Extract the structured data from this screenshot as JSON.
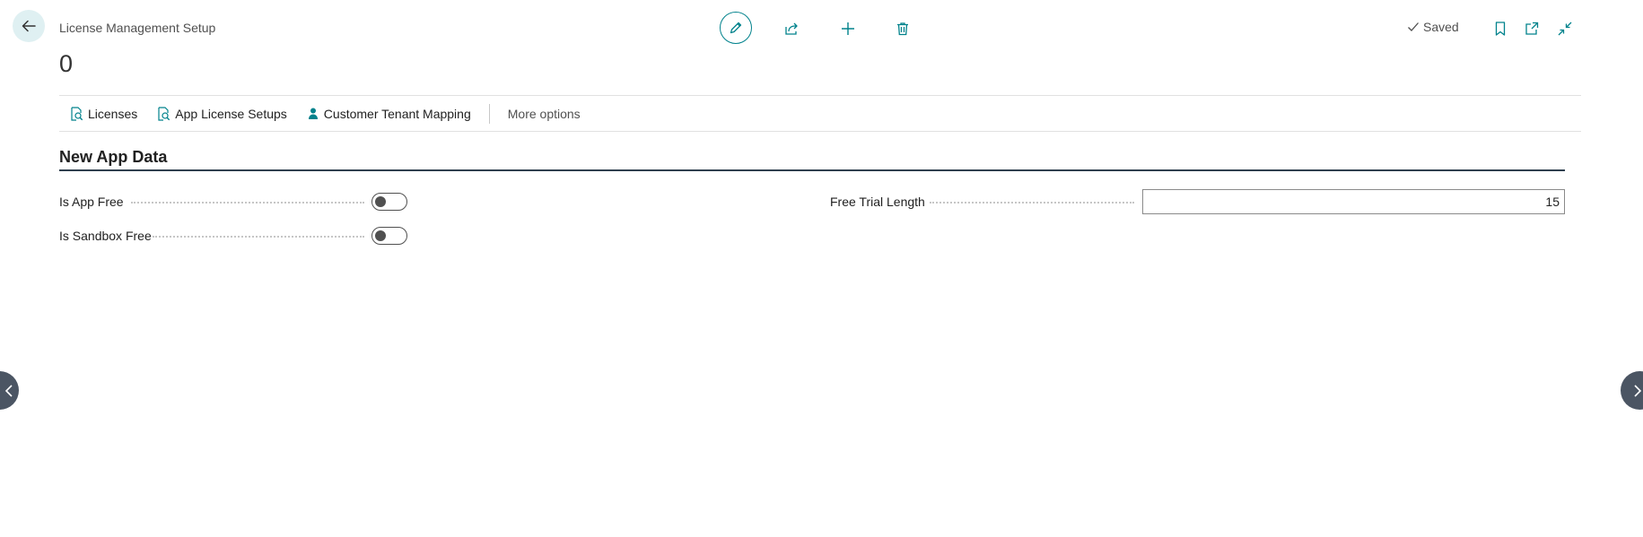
{
  "header": {
    "page_caption": "License Management Setup",
    "record_title": "0",
    "status": "Saved"
  },
  "toolbar": {
    "back": "back-arrow-icon",
    "edit": "pencil-icon",
    "share": "share-icon",
    "new": "plus-icon",
    "delete": "trash-icon",
    "bookmark": "bookmark-icon",
    "open_new_window": "open-in-new-window-icon",
    "collapse": "collapse-icon"
  },
  "actions": [
    {
      "label": "Licenses",
      "icon": "search-document-icon"
    },
    {
      "label": "App License Setups",
      "icon": "search-document-icon"
    },
    {
      "label": "Customer Tenant Mapping",
      "icon": "person-icon"
    }
  ],
  "more_options": "More options",
  "section": {
    "title": "New App Data",
    "fields": {
      "is_app_free": {
        "label": "Is App Free",
        "value": false
      },
      "is_sandbox_free": {
        "label": "Is Sandbox Free",
        "value": false
      },
      "free_trial_length": {
        "label": "Free Trial Length",
        "value": "15"
      }
    }
  },
  "colors": {
    "accent": "#00828c",
    "rule": "#2f3f4f",
    "nav_button": "#4b5563"
  }
}
